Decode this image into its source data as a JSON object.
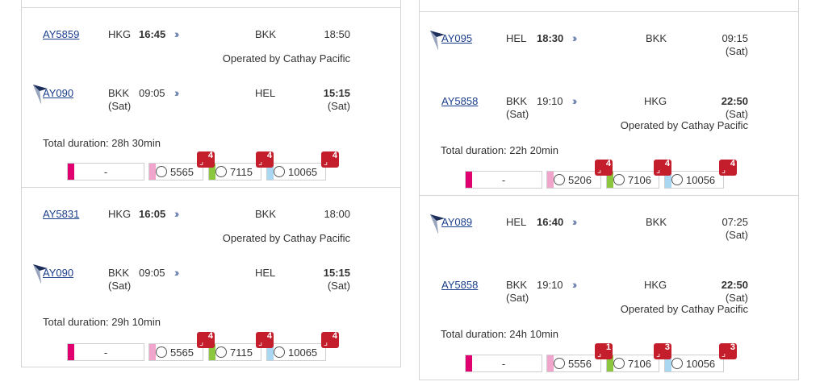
{
  "colors": {
    "business": "#e0006f",
    "economy_pink": "#f0a6cc",
    "economy_green": "#8cc63f",
    "economy_blue": "#a9d6f0",
    "badge": "#c41e2c",
    "link": "#1a3d8c"
  },
  "left": [
    {
      "out": {
        "flight": "AY5859",
        "from": "HKG",
        "dep_time": "16:45",
        "to": "BKK",
        "arr_time": "18:50",
        "operated": "Operated by Cathay Pacific"
      },
      "ret": {
        "flight": "AY090",
        "from": "BKK",
        "dep_date": "(Sat)",
        "dep_time": "09:05",
        "to": "HEL",
        "arr_time": "15:15",
        "arr_date": "(Sat)"
      },
      "duration": "Total duration: 28h 30min",
      "fares": {
        "f1": "-",
        "f2": "5565",
        "f3": "7115",
        "f4": "10065",
        "b2": "4",
        "b3": "4",
        "b4": "4"
      }
    },
    {
      "out": {
        "flight": "AY5831",
        "from": "HKG",
        "dep_time": "16:05",
        "to": "BKK",
        "arr_time": "18:00",
        "operated": "Operated by Cathay Pacific"
      },
      "ret": {
        "flight": "AY090",
        "from": "BKK",
        "dep_date": "(Sat)",
        "dep_time": "09:05",
        "to": "HEL",
        "arr_time": "15:15",
        "arr_date": "(Sat)"
      },
      "duration": "Total duration: 29h 10min",
      "fares": {
        "f1": "-",
        "f2": "5565",
        "f3": "7115",
        "f4": "10065",
        "b2": "4",
        "b3": "4",
        "b4": "4"
      }
    }
  ],
  "right": [
    {
      "out": {
        "flight": "AY095",
        "from": "HEL",
        "dep_time": "18:30",
        "to": "BKK",
        "arr_time": "09:15",
        "arr_date": "(Sat)"
      },
      "ret": {
        "flight": "AY5858",
        "from": "BKK",
        "dep_date": "(Sat)",
        "dep_time": "19:10",
        "to": "HKG",
        "arr_time": "22:50",
        "arr_date": "(Sat)",
        "operated": "Operated by Cathay Pacific"
      },
      "duration": "Total duration: 22h 20min",
      "fares": {
        "f1": "-",
        "f2": "5206",
        "f3": "7106",
        "f4": "10056",
        "b2": "4",
        "b3": "4",
        "b4": "4"
      }
    },
    {
      "out": {
        "flight": "AY089",
        "from": "HEL",
        "dep_time": "16:40",
        "to": "BKK",
        "arr_time": "07:25",
        "arr_date": "(Sat)"
      },
      "ret": {
        "flight": "AY5858",
        "from": "BKK",
        "dep_date": "(Sat)",
        "dep_time": "19:10",
        "to": "HKG",
        "arr_time": "22:50",
        "arr_date": "(Sat)",
        "operated": "Operated by Cathay Pacific"
      },
      "duration": "Total duration: 24h 10min",
      "fares": {
        "f1": "-",
        "f2": "5556",
        "f3": "7106",
        "f4": "10056",
        "b2": "1",
        "b3": "3",
        "b4": "3"
      }
    }
  ]
}
